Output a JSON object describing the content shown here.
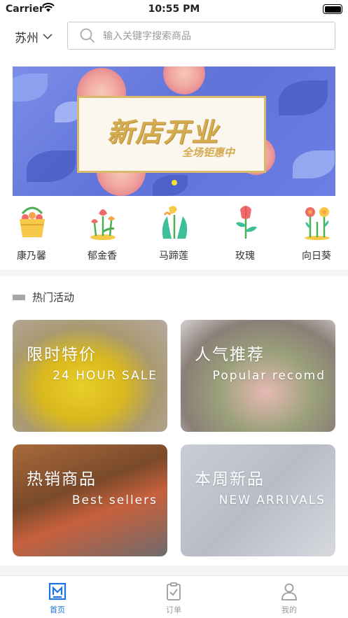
{
  "status_bar": {
    "carrier": "Carrier",
    "time": "10:55 PM"
  },
  "header": {
    "city": "苏州",
    "search_placeholder": "输入关键字搜索商品"
  },
  "banner": {
    "title": "新店开业",
    "subtitle": "全场钜惠中"
  },
  "categories": [
    {
      "label": "康乃馨",
      "icon": "carnation-basket-icon"
    },
    {
      "label": "郁金香",
      "icon": "tulip-icon"
    },
    {
      "label": "马蹄莲",
      "icon": "calla-lily-icon"
    },
    {
      "label": "玫瑰",
      "icon": "rose-icon"
    },
    {
      "label": "向日葵",
      "icon": "sunflower-icon"
    }
  ],
  "section": {
    "title": "热门活动"
  },
  "promos": [
    {
      "title": "限时特价",
      "subtitle": "24 HOUR SALE"
    },
    {
      "title": "人气推荐",
      "subtitle": "Popular recomd"
    },
    {
      "title": "热销商品",
      "subtitle": "Best sellers"
    },
    {
      "title": "本周新品",
      "subtitle": "NEW ARRIVALS"
    }
  ],
  "tabbar": {
    "items": [
      {
        "label": "首页",
        "icon": "home-icon",
        "active": true
      },
      {
        "label": "订单",
        "icon": "clipboard-icon",
        "active": false
      },
      {
        "label": "我的",
        "icon": "user-icon",
        "active": false
      }
    ]
  },
  "colors": {
    "accent": "#1a73e8",
    "banner_gold": "#d4ab4f",
    "banner_blue": "#6c7fe4"
  }
}
